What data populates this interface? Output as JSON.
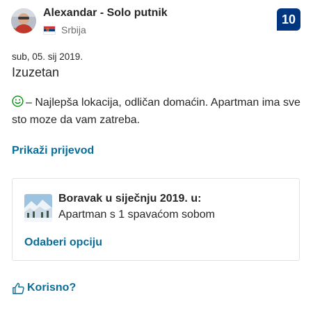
{
  "reviewer": {
    "name": "Alexandar - Solo putnik",
    "country": "Srbija",
    "avatar_icon": "avatar-photo",
    "flag_icon": "serbia-flag-icon"
  },
  "score": "10",
  "review": {
    "date": "sub, 05. sij 2019.",
    "title": "Izuzetan",
    "positive_icon": "smile-icon",
    "text": "– Najlepša lokacija, odličan domaćin. Apartman ima sve sto moze da vam zatreba."
  },
  "translate_link": "Prikaži prijevod",
  "stay": {
    "heading": "Boravak u siječnju 2019. u:",
    "room": "Apartman s 1 spavaćom sobom",
    "option_link": "Odaberi opciju"
  },
  "helpful": {
    "label": "Korisno?",
    "icon": "thumbs-up-icon"
  },
  "colors": {
    "score_badge": "#003580",
    "link": "#0b6c98",
    "positive_icon": "#008009"
  }
}
